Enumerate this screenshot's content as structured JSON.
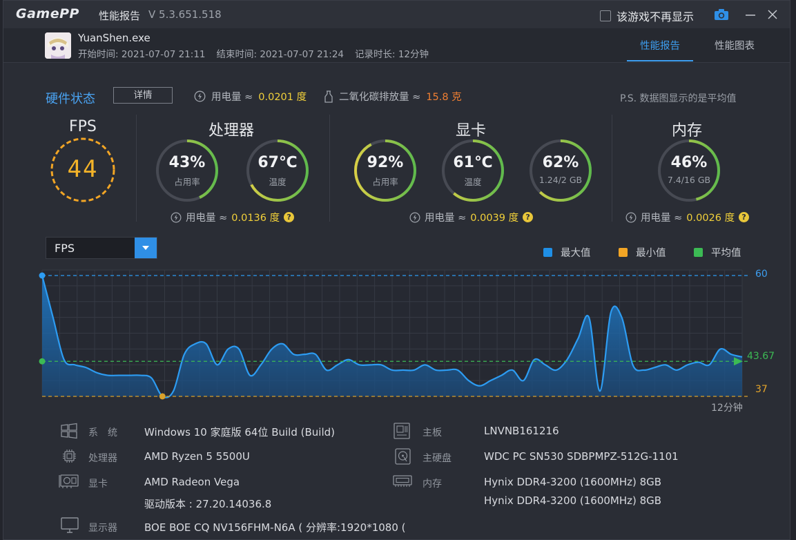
{
  "titlebar": {
    "logo": "GamePP",
    "title": "性能报告",
    "version": "V 5.3.651.518",
    "no_show_label": "该游戏不再显示"
  },
  "session": {
    "exe": "YuanShen.exe",
    "start": "开始时间: 2021-07-07 21:11",
    "end": "结束时间: 2021-07-07 21:24",
    "duration": "记录时长: 12分钟"
  },
  "tabs": [
    {
      "label": "性能报告",
      "active": true
    },
    {
      "label": "性能图表",
      "active": false
    }
  ],
  "hardware": {
    "title": "硬件状态",
    "detail_button": "详情",
    "power_label": "用电量 ≈",
    "power_value": "0.0201 度",
    "co2_label": "二氧化碳排放量 ≈",
    "co2_value": "15.8 克",
    "note": "P.S. 数据图显示的是平均值"
  },
  "fps": {
    "title": "FPS",
    "value": "44"
  },
  "cpu": {
    "title": "处理器",
    "usage": {
      "value": "43%",
      "label": "占用率",
      "percent": 43
    },
    "temp": {
      "value": "67℃",
      "label": "温度",
      "percent": 67
    },
    "power_label": "用电量 ≈",
    "power_value": "0.0136 度"
  },
  "gpu": {
    "title": "显卡",
    "usage": {
      "value": "92%",
      "label": "占用率",
      "percent": 92
    },
    "temp": {
      "value": "61℃",
      "label": "温度",
      "percent": 61
    },
    "vram": {
      "value": "62%",
      "label": "1.24/2 GB",
      "percent": 62
    },
    "power_label": "用电量 ≈",
    "power_value": "0.0039 度"
  },
  "memory": {
    "title": "内存",
    "usage": {
      "value": "46%",
      "label": "7.4/16 GB",
      "percent": 46
    },
    "power_label": "用电量 ≈",
    "power_value": "0.0026 度"
  },
  "metric_select": {
    "value": "FPS"
  },
  "legend": [
    {
      "label": "最大值",
      "color": "#1f8fe6"
    },
    {
      "label": "最小值",
      "color": "#f2a525"
    },
    {
      "label": "平均值",
      "color": "#3cba54"
    }
  ],
  "chart_data": {
    "type": "area",
    "max": 60,
    "min": 37,
    "avg": 43.67,
    "ylim": [
      37,
      60
    ],
    "x_end_label": "12分钟",
    "values": [
      60,
      52,
      44,
      43,
      42.5,
      41.5,
      41,
      41,
      41,
      41,
      40.5,
      37,
      38,
      45,
      47,
      47,
      43,
      46,
      46,
      41,
      43,
      46,
      47,
      45,
      45,
      45,
      42,
      43,
      44,
      43,
      43,
      43,
      42,
      42,
      42,
      43,
      42,
      42,
      42,
      40,
      39,
      40,
      41,
      42,
      40,
      44,
      43,
      42,
      44,
      48,
      52,
      38,
      53,
      52,
      43,
      42,
      42.5,
      43,
      42,
      43,
      43.5,
      43,
      46,
      45,
      44.5
    ]
  },
  "sysinfo": {
    "os_label": "系　统",
    "os": "Windows 10 家庭版 64位 Build (Build)",
    "cpu_label": "处理器",
    "cpu": "AMD Ryzen 5 5500U",
    "gpu_label": "显卡",
    "gpu": "AMD Radeon Vega",
    "driver": "驱动版本 : 27.20.14036.8",
    "display_label": "显示器",
    "display": "BOE BOE CQ NV156FHM-N6A ( 分辨率:1920*1080 (",
    "board_label": "主板",
    "board": "LNVNB161216",
    "disk_label": "主硬盘",
    "disk": "WDC PC SN530 SDBPMPZ-512G-1101",
    "mem_label": "内存",
    "mem1": "Hynix DDR4-3200 (1600MHz) 8GB",
    "mem2": "Hynix DDR4-3200 (1600MHz) 8GB"
  }
}
